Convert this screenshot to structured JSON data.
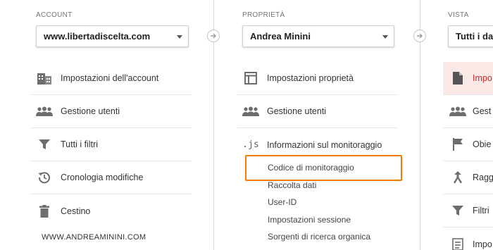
{
  "account": {
    "section_label": "ACCOUNT",
    "selected": "www.libertadiscelta.com",
    "items": [
      {
        "label": "Impostazioni dell'account",
        "icon": "building-icon"
      },
      {
        "label": "Gestione utenti",
        "icon": "people-icon"
      },
      {
        "label": "Tutti i filtri",
        "icon": "filter-icon"
      },
      {
        "label": "Cronologia modifiche",
        "icon": "history-icon"
      },
      {
        "label": "Cestino",
        "icon": "trash-icon"
      }
    ]
  },
  "property": {
    "section_label": "PROPRIETÀ",
    "selected": "Andrea Minini",
    "items": [
      {
        "label": "Impostazioni proprietà",
        "icon": "window-icon"
      },
      {
        "label": "Gestione utenti",
        "icon": "people-icon"
      },
      {
        "label": "Informazioni sul monitoraggio",
        "icon": "js-icon"
      }
    ],
    "subitems": [
      "Codice di monitoraggio",
      "Raccolta dati",
      "User-ID",
      "Impostazioni sessione",
      "Sorgenti di ricerca organica"
    ]
  },
  "view": {
    "section_label": "VISTA",
    "selected": "Tutti i da",
    "items": [
      {
        "label": "Impo",
        "icon": "document-icon",
        "active": true
      },
      {
        "label": "Gest",
        "icon": "people-icon"
      },
      {
        "label": "Obie",
        "icon": "flag-icon"
      },
      {
        "label": "Ragg",
        "icon": "merge-icon"
      },
      {
        "label": "Filtri",
        "icon": "filter-icon"
      },
      {
        "label": "Impo",
        "icon": "settings-list-icon"
      }
    ]
  },
  "watermark": "WWW.ANDREAMININI.COM",
  "colors": {
    "highlight": "#f57c00",
    "active_text": "#c62828",
    "active_bg": "#fbe9e7"
  }
}
